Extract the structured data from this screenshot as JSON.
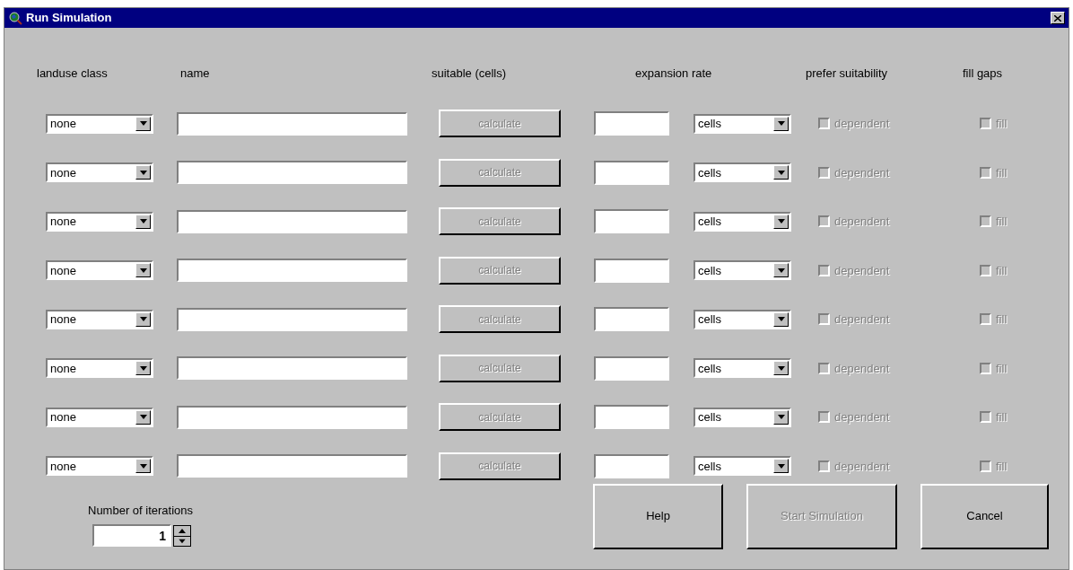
{
  "window": {
    "title": "Run Simulation"
  },
  "columns": [
    "landuse class",
    "name",
    "suitable (cells)",
    "expansion rate",
    "prefer suitability",
    "fill gaps"
  ],
  "rows": [
    {
      "landuse": "none",
      "name": "",
      "calculate": {
        "label": "calculate",
        "disabled": true
      },
      "rate": "",
      "unit": "cells",
      "dependent": {
        "label": "dependent",
        "checked": false,
        "disabled": true
      },
      "fill": {
        "label": "fill",
        "checked": false,
        "disabled": true
      }
    },
    {
      "landuse": "none",
      "name": "",
      "calculate": {
        "label": "calculate",
        "disabled": true
      },
      "rate": "",
      "unit": "cells",
      "dependent": {
        "label": "dependent",
        "checked": false,
        "disabled": true
      },
      "fill": {
        "label": "fill",
        "checked": false,
        "disabled": true
      }
    },
    {
      "landuse": "none",
      "name": "",
      "calculate": {
        "label": "calculate",
        "disabled": true
      },
      "rate": "",
      "unit": "cells",
      "dependent": {
        "label": "dependent",
        "checked": false,
        "disabled": true
      },
      "fill": {
        "label": "fill",
        "checked": false,
        "disabled": true
      }
    },
    {
      "landuse": "none",
      "name": "",
      "calculate": {
        "label": "calculate",
        "disabled": true
      },
      "rate": "",
      "unit": "cells",
      "dependent": {
        "label": "dependent",
        "checked": false,
        "disabled": true
      },
      "fill": {
        "label": "fill",
        "checked": false,
        "disabled": true
      }
    },
    {
      "landuse": "none",
      "name": "",
      "calculate": {
        "label": "calculate",
        "disabled": true
      },
      "rate": "",
      "unit": "cells",
      "dependent": {
        "label": "dependent",
        "checked": false,
        "disabled": true
      },
      "fill": {
        "label": "fill",
        "checked": false,
        "disabled": true
      }
    },
    {
      "landuse": "none",
      "name": "",
      "calculate": {
        "label": "calculate",
        "disabled": true
      },
      "rate": "",
      "unit": "cells",
      "dependent": {
        "label": "dependent",
        "checked": false,
        "disabled": true
      },
      "fill": {
        "label": "fill",
        "checked": false,
        "disabled": true
      }
    },
    {
      "landuse": "none",
      "name": "",
      "calculate": {
        "label": "calculate",
        "disabled": true
      },
      "rate": "",
      "unit": "cells",
      "dependent": {
        "label": "dependent",
        "checked": false,
        "disabled": true
      },
      "fill": {
        "label": "fill",
        "checked": false,
        "disabled": true
      }
    },
    {
      "landuse": "none",
      "name": "",
      "calculate": {
        "label": "calculate",
        "disabled": true
      },
      "rate": "",
      "unit": "cells",
      "dependent": {
        "label": "dependent",
        "checked": false,
        "disabled": true
      },
      "fill": {
        "label": "fill",
        "checked": false,
        "disabled": true
      }
    }
  ],
  "iterations": {
    "label": "Number of iterations",
    "value": "1"
  },
  "buttons": [
    {
      "label": "Help",
      "disabled": false
    },
    {
      "label": "Start Simulation",
      "disabled": true
    },
    {
      "label": "Cancel",
      "disabled": false
    }
  ]
}
